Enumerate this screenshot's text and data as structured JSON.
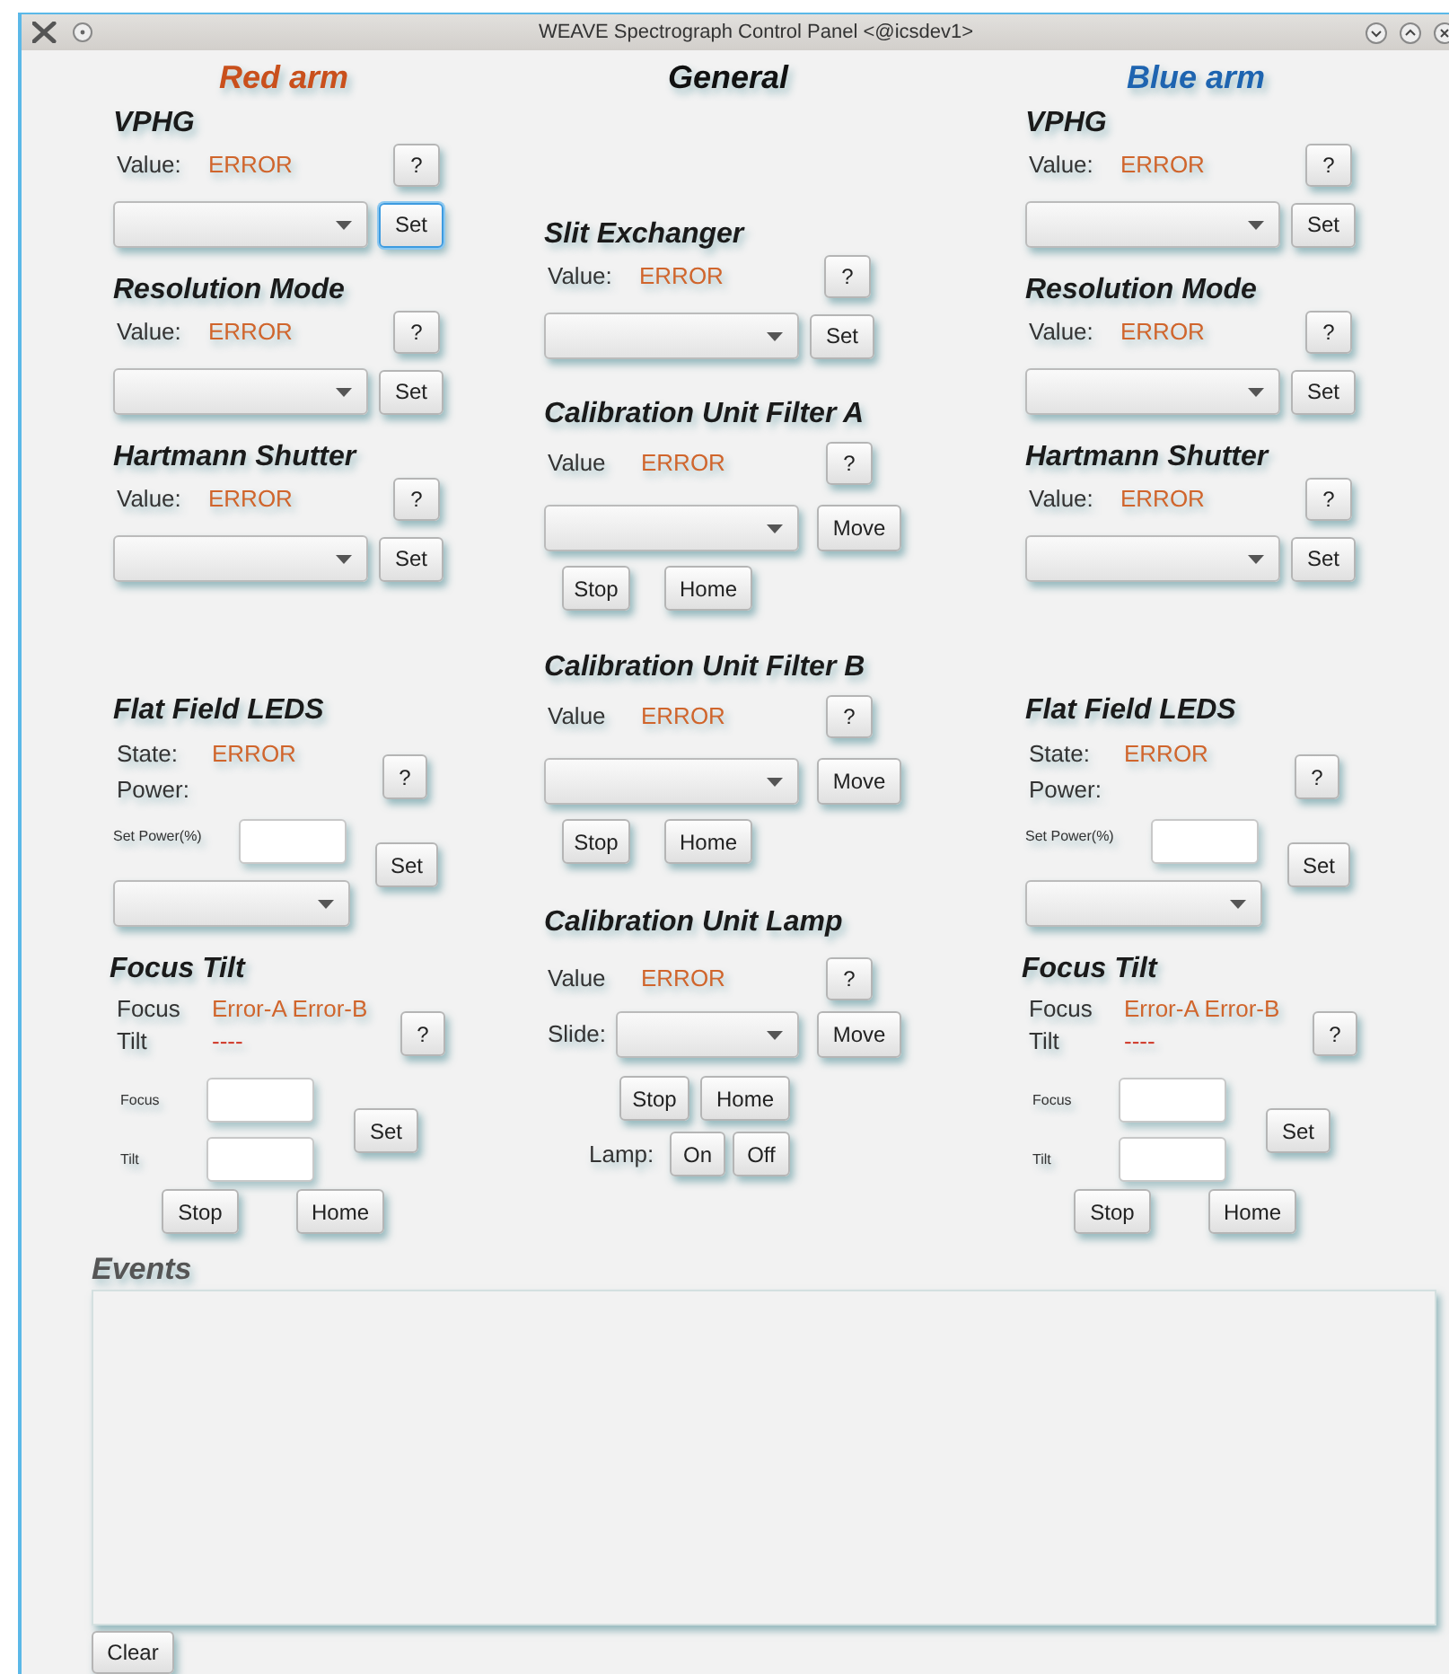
{
  "window": {
    "title": "WEAVE Spectrograph Control Panel <@icsdev1>"
  },
  "columns": [
    {
      "heading": "Red arm",
      "color": "#c9501c",
      "sections": [
        {
          "kind": "select",
          "title": "VPHG",
          "label": "Value:",
          "value": "ERROR",
          "help": "?",
          "set": "Set",
          "focused": true
        },
        {
          "kind": "select",
          "title": "Resolution Mode",
          "label": "Value:",
          "value": "ERROR",
          "help": "?",
          "set": "Set",
          "focused": false
        },
        {
          "kind": "select",
          "title": "Hartmann Shutter",
          "label": "Value:",
          "value": "ERROR",
          "help": "?",
          "set": "Set",
          "focused": false
        },
        {
          "kind": "leds",
          "title": "Flat Field LEDS",
          "state_label": "State:",
          "value": "ERROR",
          "power_label": "Power:",
          "help": "?",
          "set_power_label": "Set Power(%)",
          "set": "Set"
        },
        {
          "kind": "focus",
          "title": "Focus Tilt",
          "focus_label": "Focus",
          "focus_value": "Error-A Error-B",
          "tilt_label": "Tilt",
          "tilt_value": "----",
          "help": "?",
          "focus_field_label": "Focus",
          "tilt_field_label": "Tilt",
          "set": "Set",
          "stop": "Stop",
          "home": "Home"
        }
      ]
    },
    {
      "heading": "General",
      "color": "#111111",
      "sections": [
        {
          "kind": "select",
          "title": "Slit Exchanger",
          "label": "Value:",
          "value": "ERROR",
          "help": "?",
          "set": "Set",
          "focused": false
        },
        {
          "kind": "motor",
          "title": "Calibration Unit Filter A",
          "label": "Value",
          "value": "ERROR",
          "help": "?",
          "move": "Move",
          "stop": "Stop",
          "home": "Home"
        },
        {
          "kind": "motor",
          "title": "Calibration Unit Filter B",
          "label": "Value",
          "value": "ERROR",
          "help": "?",
          "move": "Move",
          "stop": "Stop",
          "home": "Home"
        },
        {
          "kind": "lamp",
          "title": "Calibration Unit Lamp",
          "label": "Value",
          "value": "ERROR",
          "help": "?",
          "slide_label": "Slide:",
          "move": "Move",
          "stop": "Stop",
          "home": "Home",
          "lamp_label": "Lamp:",
          "on": "On",
          "off": "Off"
        }
      ]
    },
    {
      "heading": "Blue arm",
      "color": "#1e64b0",
      "sections": [
        {
          "kind": "select",
          "title": "VPHG",
          "label": "Value:",
          "value": "ERROR",
          "help": "?",
          "set": "Set",
          "focused": false
        },
        {
          "kind": "select",
          "title": "Resolution Mode",
          "label": "Value:",
          "value": "ERROR",
          "help": "?",
          "set": "Set",
          "focused": false
        },
        {
          "kind": "select",
          "title": "Hartmann Shutter",
          "label": "Value:",
          "value": "ERROR",
          "help": "?",
          "set": "Set",
          "focused": false
        },
        {
          "kind": "leds",
          "title": "Flat Field LEDS",
          "state_label": "State:",
          "value": "ERROR",
          "power_label": "Power:",
          "help": "?",
          "set_power_label": "Set Power(%)",
          "set": "Set"
        },
        {
          "kind": "focus",
          "title": "Focus Tilt",
          "focus_label": "Focus",
          "focus_value": "Error-A Error-B",
          "tilt_label": "Tilt",
          "tilt_value": "----",
          "help": "?",
          "focus_field_label": "Focus",
          "tilt_field_label": "Tilt",
          "set": "Set",
          "stop": "Stop",
          "home": "Home"
        }
      ]
    }
  ],
  "events": {
    "title": "Events",
    "clear": "Clear"
  }
}
